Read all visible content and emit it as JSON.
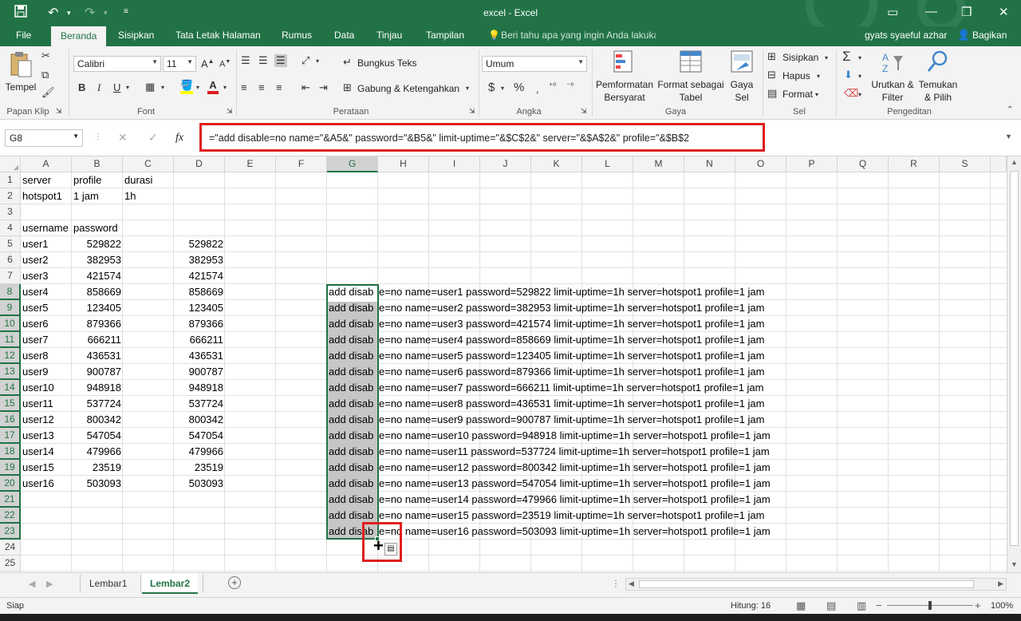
{
  "app": {
    "window_title": "excel - Excel"
  },
  "quick_access": {
    "save_icon": "save-icon",
    "undo_icon": "undo-icon",
    "redo_icon": "redo-icon",
    "customize_icon": "customize-icon"
  },
  "tabs": [
    "File",
    "Beranda",
    "Sisipkan",
    "Tata Letak Halaman",
    "Rumus",
    "Data",
    "Tinjau",
    "Tampilan"
  ],
  "tell_me": "Beri tahu apa yang ingin Anda lakukan",
  "user": {
    "name": "gyats syaeful azhar",
    "share": "Bagikan"
  },
  "ribbon": {
    "paste": "Tempel",
    "clipboard_label": "Papan Klip",
    "font_name": "Calibri",
    "font_size": "11",
    "bold": "B",
    "italic": "I",
    "underline": "U",
    "font_color_glyph": "A",
    "font_label": "Font",
    "wrap_text": "Bungkus Teks",
    "merge_center": "Gabung & Ketengahkan",
    "alignment_label": "Perataan",
    "number_format": "Umum",
    "currency": "$",
    "percent": "%",
    "number_label": "Angka",
    "cond_format": "Pemformatan Bersyarat",
    "format_table": "Format sebagai Tabel",
    "cell_styles": "Gaya Sel",
    "styles_label": "Gaya",
    "insert": "Sisipkan",
    "delete": "Hapus",
    "format": "Format",
    "cells_label": "Sel",
    "sort_filter": "Urutkan & Filter",
    "find_select": "Temukan & Pilih",
    "editing_label": "Pengeditan"
  },
  "formula_bar": {
    "name_box": "G8",
    "fx": "fx",
    "formula": "=\"add disable=no name=\"&A5&\" password=\"&B5&\" limit-uptime=\"&$C$2&\" server=\"&$A$2&\" profile=\"&$B$2"
  },
  "columns": [
    "A",
    "B",
    "C",
    "D",
    "E",
    "F",
    "G",
    "H",
    "I",
    "J",
    "K",
    "L",
    "M",
    "N",
    "O",
    "P",
    "Q",
    "R",
    "S"
  ],
  "rows": [
    "1",
    "2",
    "3",
    "4",
    "5",
    "6",
    "7",
    "8",
    "9",
    "10",
    "11",
    "12",
    "13",
    "14",
    "15",
    "16",
    "17",
    "18",
    "19",
    "20",
    "21",
    "22",
    "23",
    "24",
    "25"
  ],
  "cells": {
    "a1": "server",
    "b1": "profile",
    "c1": "durasi",
    "a2": "hotspot1",
    "b2": "1 jam",
    "c2": "1h",
    "a4": "username",
    "b4": "password"
  },
  "users": [
    {
      "name": "user1",
      "pass": "529822",
      "copy": "529822"
    },
    {
      "name": "user2",
      "pass": "382953",
      "copy": "382953"
    },
    {
      "name": "user3",
      "pass": "421574",
      "copy": "421574"
    },
    {
      "name": "user4",
      "pass": "858669",
      "copy": "858669"
    },
    {
      "name": "user5",
      "pass": "123405",
      "copy": "123405"
    },
    {
      "name": "user6",
      "pass": "879366",
      "copy": "879366"
    },
    {
      "name": "user7",
      "pass": "666211",
      "copy": "666211"
    },
    {
      "name": "user8",
      "pass": "436531",
      "copy": "436531"
    },
    {
      "name": "user9",
      "pass": "900787",
      "copy": "900787"
    },
    {
      "name": "user10",
      "pass": "948918",
      "copy": "948918"
    },
    {
      "name": "user11",
      "pass": "537724",
      "copy": "537724"
    },
    {
      "name": "user12",
      "pass": "800342",
      "copy": "800342"
    },
    {
      "name": "user13",
      "pass": "547054",
      "copy": "547054"
    },
    {
      "name": "user14",
      "pass": "479966",
      "copy": "479966"
    },
    {
      "name": "user15",
      "pass": "23519",
      "copy": "23519"
    },
    {
      "name": "user16",
      "pass": "503093",
      "copy": "503093"
    }
  ],
  "g_results": [
    {
      "left": "add disab",
      "right": "e=no name=user1 password=529822 limit-uptime=1h server=hotspot1 profile=1 jam"
    },
    {
      "left": "add disab",
      "right": "e=no name=user2 password=382953 limit-uptime=1h server=hotspot1 profile=1 jam"
    },
    {
      "left": "add disab",
      "right": "e=no name=user3 password=421574 limit-uptime=1h server=hotspot1 profile=1 jam"
    },
    {
      "left": "add disab",
      "right": "e=no name=user4 password=858669 limit-uptime=1h server=hotspot1 profile=1 jam"
    },
    {
      "left": "add disab",
      "right": "e=no name=user5 password=123405 limit-uptime=1h server=hotspot1 profile=1 jam"
    },
    {
      "left": "add disab",
      "right": "e=no name=user6 password=879366 limit-uptime=1h server=hotspot1 profile=1 jam"
    },
    {
      "left": "add disab",
      "right": "e=no name=user7 password=666211 limit-uptime=1h server=hotspot1 profile=1 jam"
    },
    {
      "left": "add disab",
      "right": "e=no name=user8 password=436531 limit-uptime=1h server=hotspot1 profile=1 jam"
    },
    {
      "left": "add disab",
      "right": "e=no name=user9 password=900787 limit-uptime=1h server=hotspot1 profile=1 jam"
    },
    {
      "left": "add disab",
      "right": "e=no name=user10 password=948918 limit-uptime=1h server=hotspot1 profile=1 jam"
    },
    {
      "left": "add disab",
      "right": "e=no name=user11 password=537724 limit-uptime=1h server=hotspot1 profile=1 jam"
    },
    {
      "left": "add disab",
      "right": "e=no name=user12 password=800342 limit-uptime=1h server=hotspot1 profile=1 jam"
    },
    {
      "left": "add disab",
      "right": "e=no name=user13 password=547054 limit-uptime=1h server=hotspot1 profile=1 jam"
    },
    {
      "left": "add disab",
      "right": "e=no name=user14 password=479966 limit-uptime=1h server=hotspot1 profile=1 jam"
    },
    {
      "left": "add disab",
      "right": "e=no name=user15 password=23519 limit-uptime=1h server=hotspot1 profile=1 jam"
    },
    {
      "left": "add disab",
      "right": "e=no name=user16 password=503093 limit-uptime=1h server=hotspot1 profile=1 jam"
    }
  ],
  "sheets": [
    "Lembar1",
    "Lembar2"
  ],
  "active_sheet": "Lembar2",
  "status": {
    "ready": "Siap",
    "count": "Hitung: 16",
    "zoom": "100%"
  },
  "colors": {
    "accent": "#217346",
    "highlight": "#e01e1e"
  }
}
